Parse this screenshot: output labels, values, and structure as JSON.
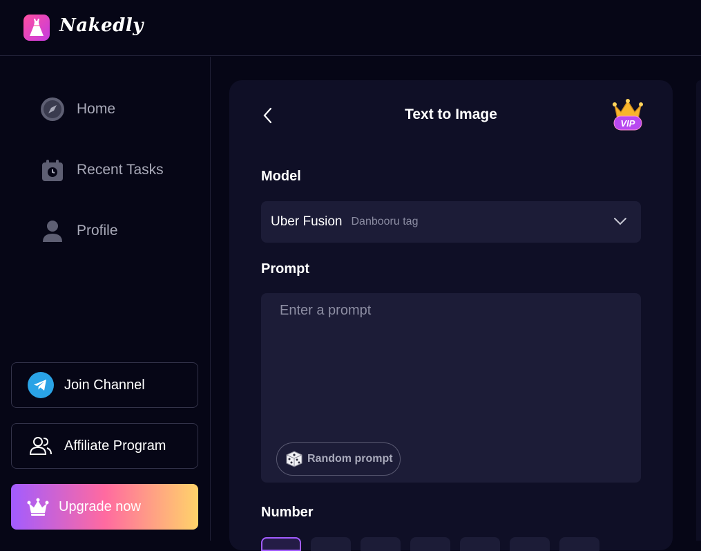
{
  "brand": {
    "name": "Nakedly"
  },
  "sidebar": {
    "items": [
      {
        "label": "Home",
        "icon": "compass-icon"
      },
      {
        "label": "Recent Tasks",
        "icon": "calendar-clock-icon"
      },
      {
        "label": "Profile",
        "icon": "user-icon"
      }
    ],
    "join_channel": "Join Channel",
    "affiliate": "Affiliate Program",
    "upgrade": "Upgrade now"
  },
  "panel": {
    "title": "Text to Image",
    "vip_badge": "VIP",
    "model_label": "Model",
    "model_name": "Uber Fusion",
    "model_tag": "Danbooru tag",
    "prompt_label": "Prompt",
    "prompt_placeholder": "Enter a prompt",
    "random_prompt": "Random prompt",
    "number_label": "Number"
  },
  "colors": {
    "background": "#060616",
    "panel": "#0f0f26",
    "field": "#1c1c37",
    "accent_purple": "#a25cff",
    "accent_pink": "#ff6aa0",
    "accent_yellow": "#ffd36a",
    "telegram": "#2aa3e6"
  }
}
